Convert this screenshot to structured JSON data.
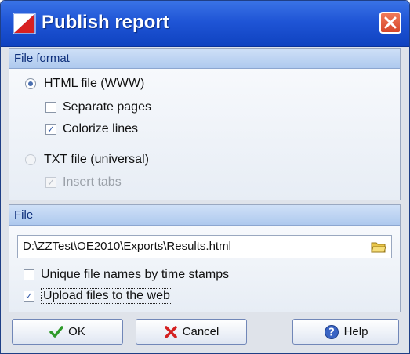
{
  "dialog": {
    "title": "Publish report"
  },
  "file_format": {
    "header": "File format",
    "html_option": "HTML file (WWW)",
    "separate_pages": "Separate pages",
    "colorize_lines": "Colorize lines",
    "txt_option": "TXT file (universal)",
    "insert_tabs": "Insert tabs"
  },
  "file": {
    "header": "File",
    "path": "D:\\ZZTest\\OE2010\\Exports\\Results.html",
    "unique_names": "Unique file names by time stamps",
    "upload": "Upload files to the web"
  },
  "buttons": {
    "ok": "OK",
    "cancel": "Cancel",
    "help": "Help"
  },
  "state": {
    "format_selected": "HTML file (WWW)",
    "separate_pages_checked": false,
    "colorize_lines_checked": true,
    "insert_tabs_checked": true,
    "unique_names_checked": false,
    "upload_checked": true
  },
  "colors": {
    "title_bar": "#1f55d6",
    "panel_header": "#aec9ee",
    "ok_check": "#2f9a2a",
    "cancel_x": "#d42020"
  }
}
